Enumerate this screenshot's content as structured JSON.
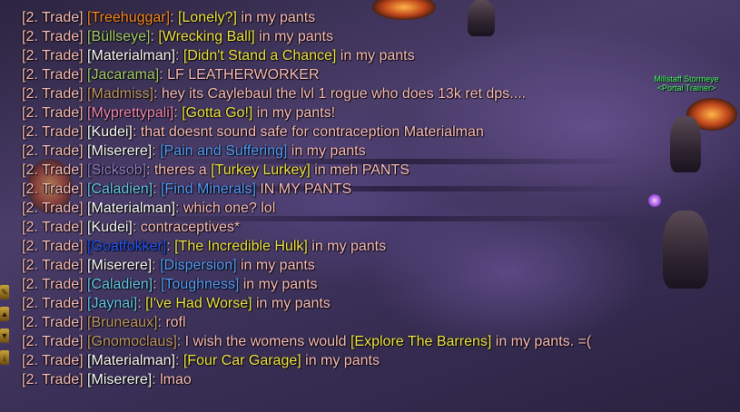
{
  "nameplate": {
    "name": "Millstaff Stormeye",
    "title": "<Portal Trainer>"
  },
  "colors": {
    "chat_default": "#ffc0c0",
    "item_rare": "#f5e84a",
    "item_blue": "#5aa0ff",
    "npc_name": "#3fff5a"
  },
  "sidebar": {
    "buttons": [
      {
        "icon": "chat-icon"
      },
      {
        "icon": "scroll-up-icon"
      },
      {
        "icon": "scroll-down-icon"
      },
      {
        "icon": "scroll-bottom-icon"
      }
    ]
  },
  "chat": {
    "lines": [
      {
        "channel": "[2. Trade] ",
        "name": "[Treehuggar]",
        "name_color": "#ff8c28",
        "pre": ":  ",
        "item": "[Lonely?]",
        "item_color": "#f5e84a",
        "post": " in my pants"
      },
      {
        "channel": "[2. Trade] ",
        "name": "[Büllseye]",
        "name_color": "#a9d271",
        "pre": ":   ",
        "item": "[Wrecking Ball]",
        "item_color": "#f5e84a",
        "post": " in my pants"
      },
      {
        "channel": "[2. Trade] ",
        "name": "[Materialman]",
        "name_color": "#ffffff",
        "pre": ":  ",
        "item": "[Didn't Stand a Chance]",
        "item_color": "#f5e84a",
        "post": " in my pants"
      },
      {
        "channel": "[2. Trade] ",
        "name": "[Jacarama]",
        "name_color": "#a9d271",
        "pre": ": LF LEATHERWORKER",
        "item": "",
        "item_color": "#f5e84a",
        "post": ""
      },
      {
        "channel": "[2. Trade] ",
        "name": "[Madmiss]",
        "name_color": "#c79c6e",
        "pre": ": hey its Caylebaul the lvl 1 rogue who does 13k ret dps....",
        "item": "",
        "item_color": "#f5e84a",
        "post": ""
      },
      {
        "channel": "[2. Trade] ",
        "name": "[Myprettypali]",
        "name_color": "#f58cba",
        "pre": ":  ",
        "item": "[Gotta Go!]",
        "item_color": "#f5e84a",
        "post": " in my pants!"
      },
      {
        "channel": "[2. Trade] ",
        "name": "[Kudei]",
        "name_color": "#ffffff",
        "pre": ": that doesnt sound safe for contraception Materialman",
        "item": "",
        "item_color": "#f5e84a",
        "post": ""
      },
      {
        "channel": "[2. Trade] ",
        "name": "[Miserere]",
        "name_color": "#ffffff",
        "pre": ":  ",
        "item": "[Pain and Suffering]",
        "item_color": "#5aa0ff",
        "post": " in my pants"
      },
      {
        "channel": "[2. Trade] ",
        "name": "[Sicksob]",
        "name_color": "#9482c9",
        "pre": ": theres a  ",
        "item": "[Turkey Lurkey]",
        "item_color": "#f5e84a",
        "post": " in meh PANTS"
      },
      {
        "channel": "[2. Trade] ",
        "name": "[Caladien]",
        "name_color": "#69ccf0",
        "pre": ":  ",
        "item": "[Find Minerals]",
        "item_color": "#5aa0ff",
        "post": " IN MY PANTS"
      },
      {
        "channel": "[2. Trade] ",
        "name": "[Materialman]",
        "name_color": "#ffffff",
        "pre": ": which one? lol",
        "item": "",
        "item_color": "#f5e84a",
        "post": ""
      },
      {
        "channel": "[2. Trade] ",
        "name": "[Kudei]",
        "name_color": "#ffffff",
        "pre": ": contraceptives*",
        "item": "",
        "item_color": "#f5e84a",
        "post": ""
      },
      {
        "channel": "[2. Trade] ",
        "name": "[Goatfokker]",
        "name_color": "#2459ff",
        "pre": ":  ",
        "item": "[The Incredible Hulk]",
        "item_color": "#f5e84a",
        "post": " in my pants"
      },
      {
        "channel": "[2. Trade] ",
        "name": "[Miserere]",
        "name_color": "#ffffff",
        "pre": ":  ",
        "item": "[Dispersion]",
        "item_color": "#5aa0ff",
        "post": " in my pants"
      },
      {
        "channel": "[2. Trade] ",
        "name": "[Caladien]",
        "name_color": "#69ccf0",
        "pre": ":  ",
        "item": "[Toughness]",
        "item_color": "#5aa0ff",
        "post": " in my pants"
      },
      {
        "channel": "[2. Trade] ",
        "name": "[Jaynai]",
        "name_color": "#69ccf0",
        "pre": ":  ",
        "item": "[I've Had Worse]",
        "item_color": "#f5e84a",
        "post": " in my pants"
      },
      {
        "channel": "[2. Trade] ",
        "name": "[Bruneaux]",
        "name_color": "#c79c6e",
        "pre": ": rofl",
        "item": "",
        "item_color": "#f5e84a",
        "post": ""
      },
      {
        "channel": "[2. Trade] ",
        "name": "[Gnomoclaus]",
        "name_color": "#c79c6e",
        "pre": ": I wish the womens would  ",
        "item": "[Explore The Barrens]",
        "item_color": "#f5e84a",
        "post": " in my pants. =(",
        "wrap": true
      },
      {
        "channel": "[2. Trade] ",
        "name": "[Materialman]",
        "name_color": "#ffffff",
        "pre": ":  ",
        "item": "[Four Car Garage]",
        "item_color": "#f5e84a",
        "post": " in my pants"
      },
      {
        "channel": "[2. Trade] ",
        "name": "[Miserere]",
        "name_color": "#ffffff",
        "pre": ": lmao",
        "item": "",
        "item_color": "#f5e84a",
        "post": ""
      }
    ]
  }
}
